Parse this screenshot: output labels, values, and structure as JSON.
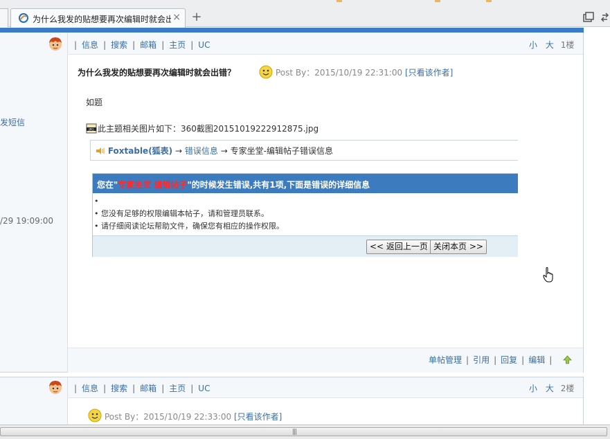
{
  "browser": {
    "tab_title": "为什么我发的贴想要再次编辑时就会出",
    "close_glyph": "×",
    "new_tab_glyph": "+"
  },
  "post1": {
    "nav": {
      "info": "信息",
      "search": "搜索",
      "mail": "邮箱",
      "home": "主页",
      "uc": "UC",
      "sep": "|"
    },
    "size_small": "小",
    "size_large": "大",
    "floor": "1楼",
    "title": "为什么我发的贴想要再次编辑时就会出错？",
    "post_by": "Post By：2015/10/19 22:31:00",
    "only_author": "[只看该作者]",
    "body": "如题",
    "attachment_label": "此主题相关图片如下：360截图20151019222912875.jpg",
    "breadcrumb": {
      "site": "Foxtable(狐表)",
      "arrow": "→",
      "section": "错误信息",
      "page": "专家坐堂-编辑帖子错误信息"
    },
    "error": {
      "header_pre": "您在\"",
      "header_hl": "专家坐堂 编辑帖子",
      "header_post": "\"的时候发生错误,共有1项,下面是错误的详细信息",
      "items": [
        "•",
        "•  您没有足够的权限编辑本帖子，请和管理员联系。",
        "•  请仔细阅读论坛帮助文件，确保您有相应的操作权限。"
      ],
      "back_button": "<< 返回上一页",
      "close_button": "关闭本页 >>"
    },
    "footer": {
      "manage": "单帖管理",
      "quote": "引用",
      "reply": "回复",
      "edit": "编辑",
      "sep": "|"
    }
  },
  "left_column": {
    "send_sms": "发短信",
    "time": "/29 19:09:00"
  },
  "post2": {
    "nav": {
      "info": "信息",
      "search": "搜索",
      "mail": "邮箱",
      "home": "主页",
      "uc": "UC",
      "sep": "|"
    },
    "size_small": "小",
    "size_large": "大",
    "floor": "2楼",
    "post_by": "Post By：2015/10/19 22:33:00",
    "only_author": "[只看该作者]"
  },
  "scrollbar": {
    "grip": "|||"
  },
  "colors": {
    "accent_blue": "#3b7cc7",
    "link": "#3a6ea5",
    "error_header": "#3d7bbf",
    "error_highlight": "#ff2a2a",
    "panel_bg": "#f5f8fb"
  }
}
